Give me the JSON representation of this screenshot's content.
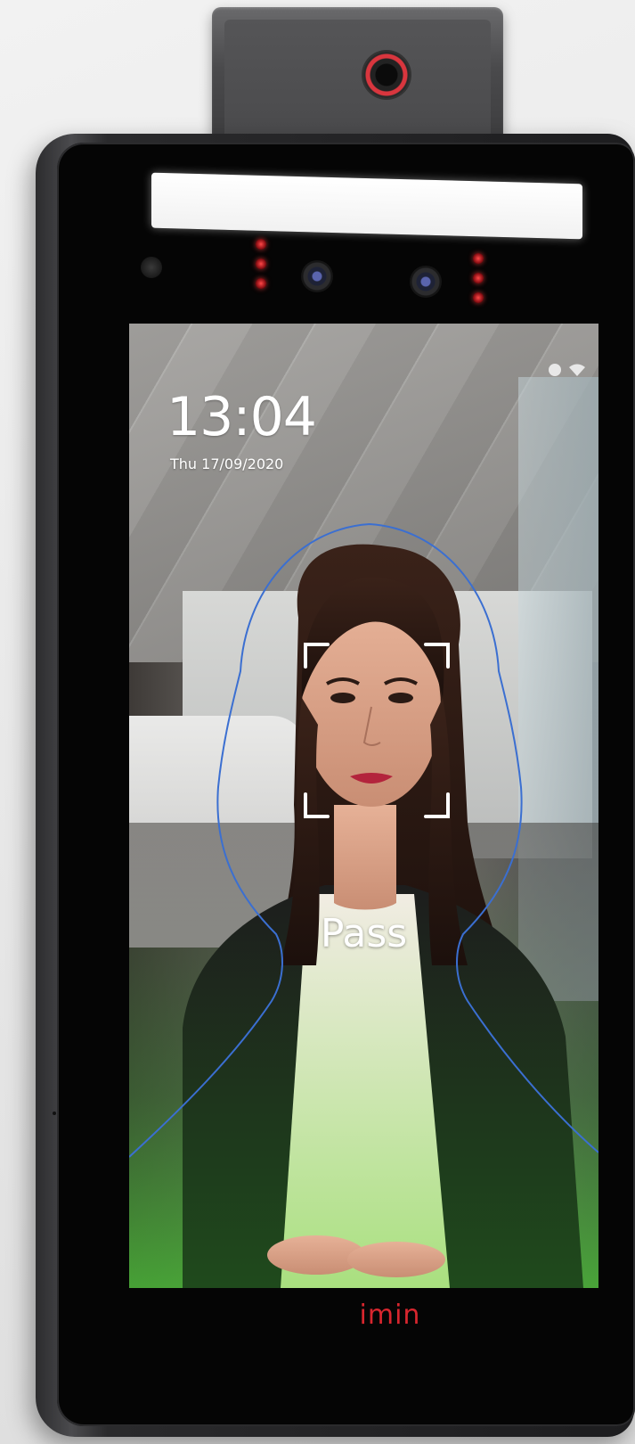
{
  "device": {
    "brand": "imin",
    "accent_color": "#d8262e",
    "bezel_color": "#050505",
    "body_color": "#2a2a2c"
  },
  "screen": {
    "time": "13:04",
    "date": "Thu 17/09/2020",
    "result_text": "Pass",
    "status_icons": [
      "status-dot-icon",
      "wifi-icon"
    ],
    "overlay_color": "#3b6fd1",
    "face_frame_color": "#ffffff",
    "pass_gradient_color": "#50c83c"
  }
}
